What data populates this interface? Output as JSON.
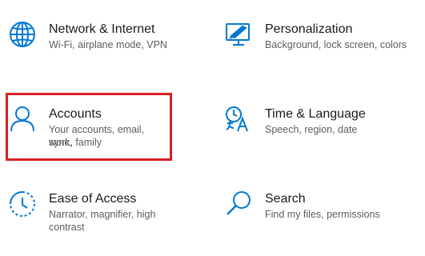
{
  "accent_color": "#0078d4",
  "highlight_color": "#d81f26",
  "tiles": [
    {
      "title": "Network & Internet",
      "desc": "Wi-Fi, airplane mode, VPN",
      "icon": "globe-icon"
    },
    {
      "title": "Personalization",
      "desc": "Background, lock screen, colors",
      "icon": "paintbrush-monitor-icon"
    },
    {
      "title": "Accounts",
      "desc_line1": "Your accounts, email, sync,",
      "desc_line2": "work, family",
      "icon": "person-icon"
    },
    {
      "title": "Time & Language",
      "desc": "Speech, region, date",
      "icon": "time-language-icon"
    },
    {
      "title": "Ease of Access",
      "desc_line1": "Narrator, magnifier, high",
      "desc_line2": "contrast",
      "icon": "ease-of-access-icon"
    },
    {
      "title": "Search",
      "desc": "Find my files, permissions",
      "icon": "search-icon"
    }
  ]
}
